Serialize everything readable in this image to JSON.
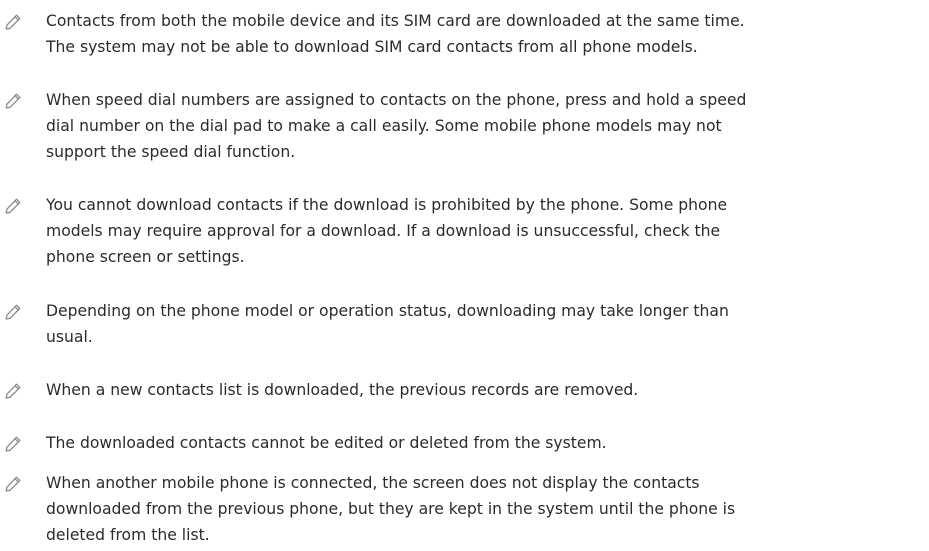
{
  "notes": [
    {
      "icon": "pencil-icon",
      "lines": [
        "Contacts from both the mobile device and its SIM card are downloaded at the same time.",
        "The system may not be able to download SIM card contacts from all phone models."
      ]
    },
    {
      "icon": "pencil-icon",
      "lines": [
        "When speed dial numbers are assigned to contacts on the phone, press and hold a speed",
        "dial number on the dial pad to make a call easily. Some mobile phone models may not",
        "support the speed dial function."
      ]
    },
    {
      "icon": "pencil-icon",
      "lines": [
        "You cannot download contacts if the download is prohibited by the phone. Some phone",
        "models may require approval for a download. If a download is unsuccessful, check the",
        "phone screen or settings."
      ]
    },
    {
      "icon": "pencil-icon",
      "lines": [
        "Depending on the phone model or operation status, downloading may take longer than",
        "usual."
      ]
    },
    {
      "icon": "pencil-icon",
      "lines": [
        "When a new contacts list is downloaded, the previous records are removed."
      ]
    },
    {
      "icon": "pencil-icon",
      "lines": [
        "The downloaded contacts cannot be edited or deleted from the system."
      ]
    },
    {
      "icon": "pencil-icon",
      "lines": [
        "When another mobile phone is connected, the screen does not display the contacts",
        "downloaded from the previous phone, but they are kept in the system until the phone is",
        "deleted from the list."
      ]
    }
  ]
}
